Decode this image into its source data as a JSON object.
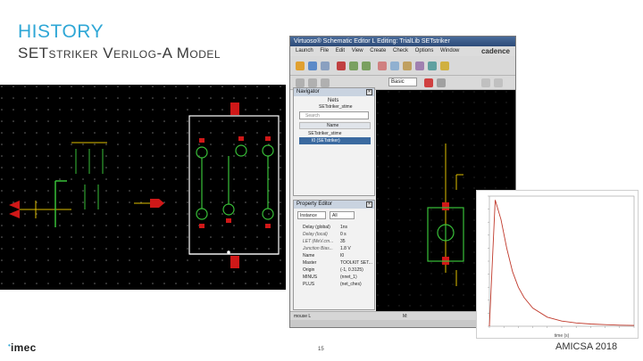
{
  "slide": {
    "title": "HISTORY",
    "subtitle": "SETstriker Verilog-A Model",
    "footer_logo": "imec",
    "page_number": "15",
    "footer_right": "AMICSA 2018"
  },
  "virtuoso": {
    "title": "Virtuoso® Schematic Editor L Editing: TrialLib SETstriker",
    "menu": [
      "Launch",
      "File",
      "Edit",
      "View",
      "Create",
      "Check",
      "Options",
      "Window"
    ],
    "brand": "cadence",
    "search_value": "Basic",
    "navigator": {
      "title": "Navigator",
      "view_label": "Nets",
      "cell_label": "SETstriker_stime",
      "search_placeholder": "Search",
      "column_header": "Name",
      "rows": [
        "SETstriker_stime",
        "I0 (SETstriker)"
      ]
    },
    "property_editor": {
      "title": "Property Editor",
      "filter_value": "Instance",
      "filter2_value": "All",
      "rows": [
        {
          "key": "Delay (global)",
          "value": "1ns"
        },
        {
          "key": "Delay (local)",
          "value": "0 s"
        },
        {
          "key": "LET (MeV.cm...",
          "value": "35"
        },
        {
          "key": "Junction Bias...",
          "value": "1.8 V"
        },
        {
          "key": "Name",
          "value": "I0"
        },
        {
          "key": "Master",
          "value": "TOOLKIT SET..."
        },
        {
          "key": "Origin",
          "value": "(-1, 0.3125)"
        },
        {
          "key": "MINUS",
          "value": "(nnet_1)"
        },
        {
          "key": "PLUS",
          "value": "(net_ches)"
        }
      ]
    },
    "status_left": "mouse L",
    "status_mid": "M:"
  },
  "chart_data": {
    "type": "line",
    "title": "",
    "xlabel": "time (s)",
    "ylabel": "",
    "xlim": [
      0,
      0.5
    ],
    "ylim": [
      0,
      1.0
    ],
    "series": [
      {
        "x": [
          0.0,
          0.02,
          0.04,
          0.06,
          0.08,
          0.1,
          0.12,
          0.15,
          0.2,
          0.25,
          0.3,
          0.35,
          0.4,
          0.45,
          0.5
        ],
        "values": [
          0.0,
          0.97,
          0.82,
          0.6,
          0.42,
          0.3,
          0.22,
          0.14,
          0.07,
          0.04,
          0.025,
          0.017,
          0.012,
          0.008,
          0.006
        ]
      }
    ],
    "grid": false,
    "line_color": "#c0392b"
  }
}
